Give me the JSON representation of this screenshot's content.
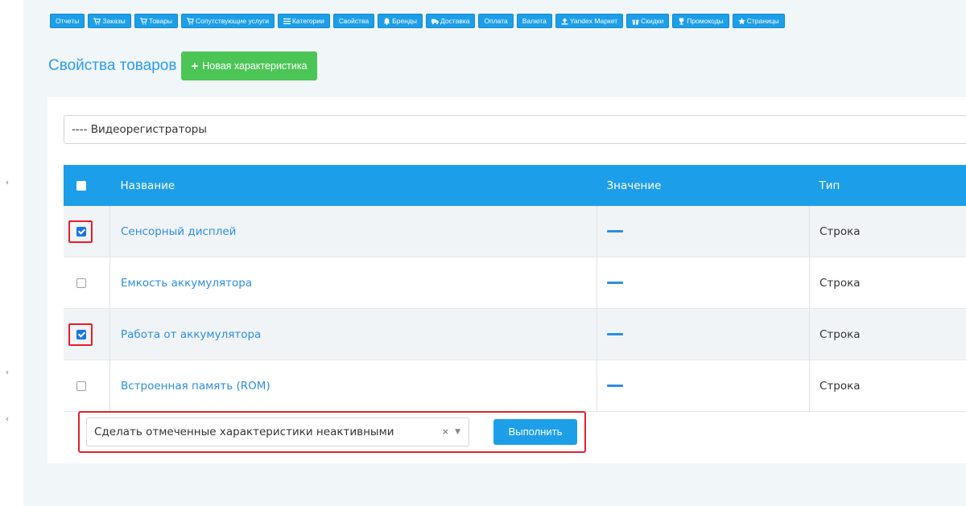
{
  "nav": [
    {
      "label": "Отчеты",
      "icon": ""
    },
    {
      "label": "Заказы",
      "icon": "cart-icon"
    },
    {
      "label": "Товары",
      "icon": "cart-icon"
    },
    {
      "label": "Сопутствующие услуги",
      "icon": "cart-icon"
    },
    {
      "label": "Категории",
      "icon": "list-icon"
    },
    {
      "label": "Свойства",
      "icon": ""
    },
    {
      "label": "Бренды",
      "icon": "bell-icon"
    },
    {
      "label": "Доставка",
      "icon": "truck-icon"
    },
    {
      "label": "Оплата",
      "icon": ""
    },
    {
      "label": "Валюта",
      "icon": ""
    },
    {
      "label": "Yandex Маркет",
      "icon": "upload-icon"
    },
    {
      "label": "Скидки",
      "icon": "gift-icon"
    },
    {
      "label": "Промокоды",
      "icon": "trophy-icon"
    },
    {
      "label": "Страницы",
      "icon": "star-icon"
    }
  ],
  "page": {
    "title": "Свойства товаров",
    "new_button": "Новая характеристика"
  },
  "category_select": {
    "value": "---- Видеорегистраторы"
  },
  "table": {
    "columns": [
      "Название",
      "Значение",
      "Тип"
    ],
    "rows": [
      {
        "name": "Сенсорный дисплей",
        "type": "Строка",
        "checked": true,
        "highlighted": true
      },
      {
        "name": "Емкость аккумулятора",
        "type": "Строка",
        "checked": false,
        "highlighted": false
      },
      {
        "name": "Работа от аккумулятора",
        "type": "Строка",
        "checked": true,
        "highlighted": true
      },
      {
        "name": "Встроенная память (ROM)",
        "type": "Строка",
        "checked": false,
        "highlighted": false
      }
    ]
  },
  "bulk_action": {
    "value": "Сделать отмеченные характеристики неактивными",
    "clear": "×",
    "run_button": "Выполнить"
  },
  "colors": {
    "accent": "#1d9ee8",
    "success": "#4cc557",
    "highlight": "#e61e2b"
  }
}
